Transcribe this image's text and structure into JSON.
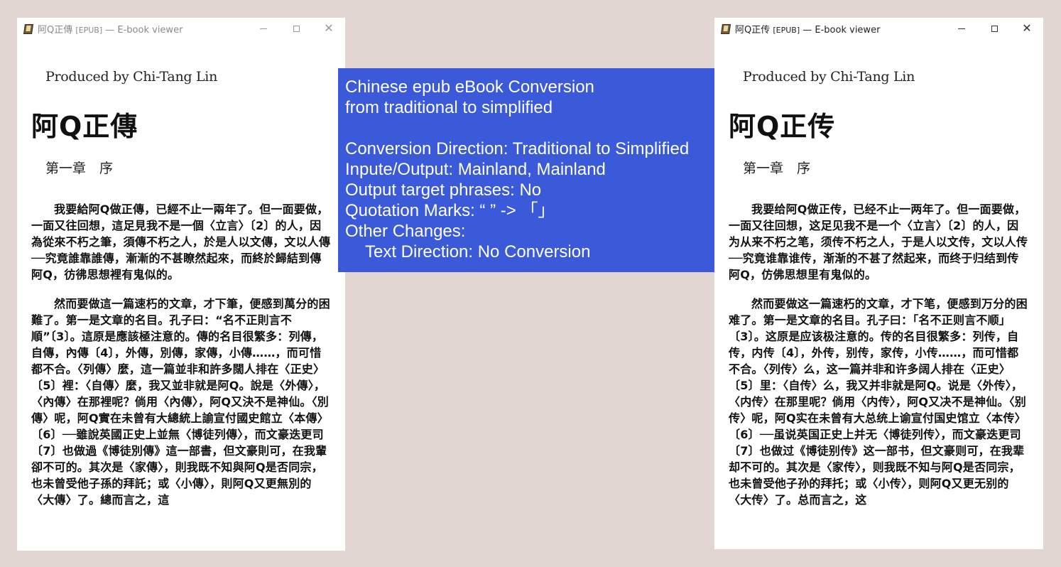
{
  "left_window": {
    "title": "阿Q正傳",
    "title_tag": "[EPUB]",
    "title_suffix": " — E-book viewer",
    "producer": "Produced by Chi-Tang Lin",
    "book_title": "阿Q正傳",
    "chapter": "第一章　序",
    "paragraphs": [
      "我要給阿Q做正傳，已經不止一兩年了。但一面要做，一面又往回想，這足見我不是一個〈立言〉〔2〕的人，因為從來不朽之筆，須傳不朽之人，於是人以文傳，文以人傳──究竟誰靠誰傳，漸漸的不甚瞭然起來，而終於歸結到傳阿Q，彷彿思想裡有鬼似的。",
      "然而要做這一篇速朽的文章，才下筆，便感到萬分的困難了。第一是文章的名目。孔子曰：“名不正則言不順”〔3〕。這原是應該極注意的。傳的名目很繁多：列傳，自傳，內傳〔4〕，外傳，別傳，家傳，小傳……，而可惜都不合。〈列傳〉麼，這一篇並非和許多闊人排在〈正史〉〔5〕裡：〈自傳〉麼，我又並非就是阿Q。說是〈外傳〉，〈內傳〉在那裡呢？倘用〈內傳〉，阿Q又決不是神仙。〈別傳〉呢，阿Q實在未曾有大總統上諭宣付國史館立〈本傳〉〔6〕──雖說英國正史上並無〈博徒列傳〉，而文豪迭更司〔7〕也做過《博徒別傳》這一部書，但文豪則可，在我輩卻不可的。其次是〈家傳〉，則我既不知與阿Q是否同宗，也未曾受他子孫的拜託；或〈小傳〉，則阿Q又更無別的〈大傳〉了。總而言之，這"
    ]
  },
  "right_window": {
    "title": "阿Q正传",
    "title_tag": "[EPUB]",
    "title_suffix": " — E-book viewer",
    "producer": "Produced by Chi-Tang Lin",
    "book_title": "阿Q正传",
    "chapter": "第一章　序",
    "paragraphs": [
      "我要给阿Q做正传，已经不止一两年了。但一面要做，一面又往回想，这足见我不是一个〈立言〉〔2〕的人，因为从来不朽之笔，须传不朽之人，于是人以文传，文以人传──究竟谁靠谁传，渐渐的不甚了然起来，而终于归结到传阿Q，仿佛思想里有鬼似的。",
      "然而要做这一篇速朽的文章，才下笔，便感到万分的困难了。第一是文章的名目。孔子曰：「名不正则言不顺」〔3〕。这原是应该极注意的。传的名目很繁多：列传，自传，内传〔4〕，外传，别传，家传，小传……，而可惜都不合。〈列传〉么，这一篇并非和许多阔人排在〈正史〉〔5〕里：〈自传〉么，我又并非就是阿Q。说是〈外传〉，〈内传〉在那里呢？倘用〈内传〉，阿Q又决不是神仙。〈别传〉呢，阿Q实在未曾有大总统上谕宣付国史馆立〈本传〉〔6〕──虽说英国正史上并无〈博徒列传〉，而文豪迭更司〔7〕也做过《博徒别传》这一部书，但文豪则可，在我辈却不可的。其次是〈家传〉，则我既不知与阿Q是否同宗，也未曾受他子孙的拜托；或〈小传〉，则阿Q又更无别的〈大传〉了。总而言之，这"
    ]
  },
  "window_controls": {
    "close": "✕"
  },
  "info": {
    "heading_line1": "Chinese epub eBook Conversion",
    "heading_line2": "from traditional to simplified",
    "direction": "Conversion Direction: Traditional to Simplified",
    "io": "Inpute/Output: Mainland, Mainland",
    "phrases": "Output target phrases: No",
    "quotes": "Quotation Marks: “ ” -> 「」",
    "other": "Other Changes:",
    "text_direction": "Text Direction: No Conversion"
  },
  "colors": {
    "panel_bg": "#3a5ad9",
    "desktop_bg": "#e1d6d1"
  }
}
